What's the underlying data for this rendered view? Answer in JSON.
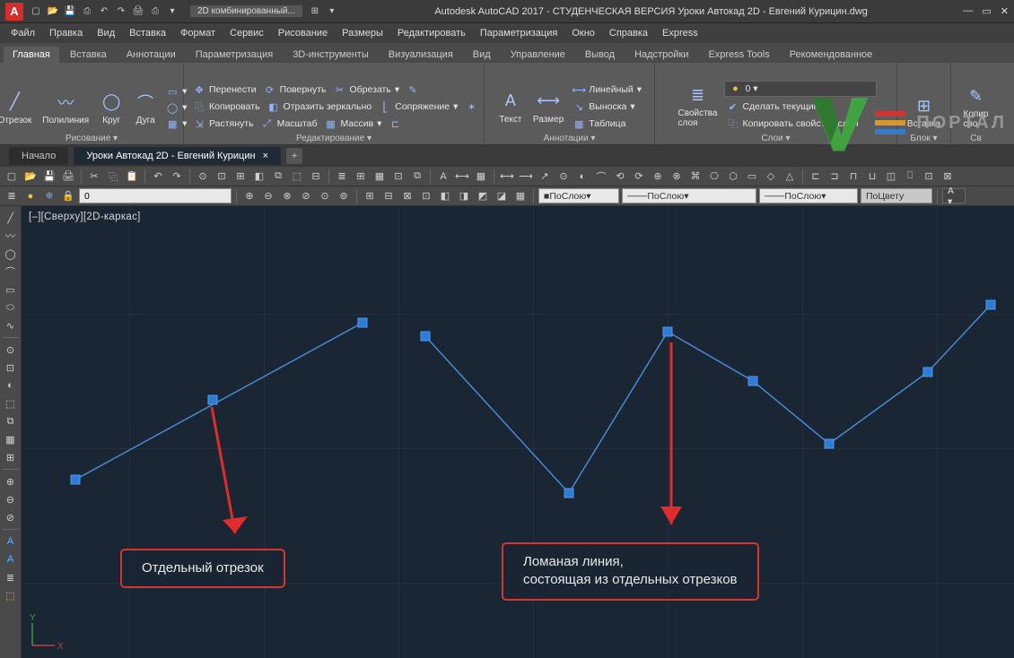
{
  "titlebar": {
    "logo": "A",
    "workspace": "2D комбинированный...",
    "title": "Autodesk AutoCAD 2017 - СТУДЕНЧЕСКАЯ ВЕРСИЯ   Уроки Автокад 2D - Евгений Курицин.dwg"
  },
  "menu": [
    "Файл",
    "Правка",
    "Вид",
    "Вставка",
    "Формат",
    "Сервис",
    "Рисование",
    "Размеры",
    "Редактировать",
    "Параметризация",
    "Окно",
    "Справка",
    "Express"
  ],
  "ribbonTabs": [
    "Главная",
    "Вставка",
    "Аннотации",
    "Параметризация",
    "3D-инструменты",
    "Визуализация",
    "Вид",
    "Управление",
    "Вывод",
    "Надстройки",
    "Express Tools",
    "Рекомендованное"
  ],
  "activeRibbonTab": 0,
  "ribbon": {
    "draw": {
      "label": "Рисование ▾",
      "items": {
        "line": "Отрезок",
        "polyline": "Полилиния",
        "circle": "Круг",
        "arc": "Дуга"
      }
    },
    "modify": {
      "label": "Редактирование ▾",
      "r1": {
        "move": "Перенести",
        "rotate": "Повернуть",
        "trim": "Обрезать"
      },
      "r2": {
        "copy": "Копировать",
        "mirror": "Отразить зеркально",
        "fillet": "Сопряжение"
      },
      "r3": {
        "stretch": "Растянуть",
        "scale": "Масштаб",
        "array": "Массив"
      }
    },
    "annot": {
      "label": "Аннотации ▾",
      "text": "Текст",
      "dim": "Размер",
      "linear": "Линейный",
      "leader": "Выноска",
      "table": "Таблица"
    },
    "layers": {
      "label": "Слои ▾",
      "props": "Свойства\nслоя",
      "makecur": "Сделать текущим",
      "copyprops": "Копировать свойства слоя"
    },
    "block": {
      "label": "Блок ▾",
      "insert": "Вставка"
    },
    "props": {
      "label": "Св",
      "copy": "Копир\nсво"
    }
  },
  "docTabs": {
    "start": "Начало",
    "active": "Уроки Автокад 2D - Евгений Курицин"
  },
  "propRow": {
    "byLayer": "ПоСлою",
    "byColor": "ПоЦвету",
    "layer0": "0"
  },
  "canvas": {
    "viewLabel": "[–][Сверху][2D-каркас]",
    "callout1": "Отдельный отрезок",
    "callout2_l1": "Ломаная линия,",
    "callout2_l2": "состоящая из отдельных отрезков"
  },
  "watermark": {
    "text": "ПОРТАЛ"
  }
}
